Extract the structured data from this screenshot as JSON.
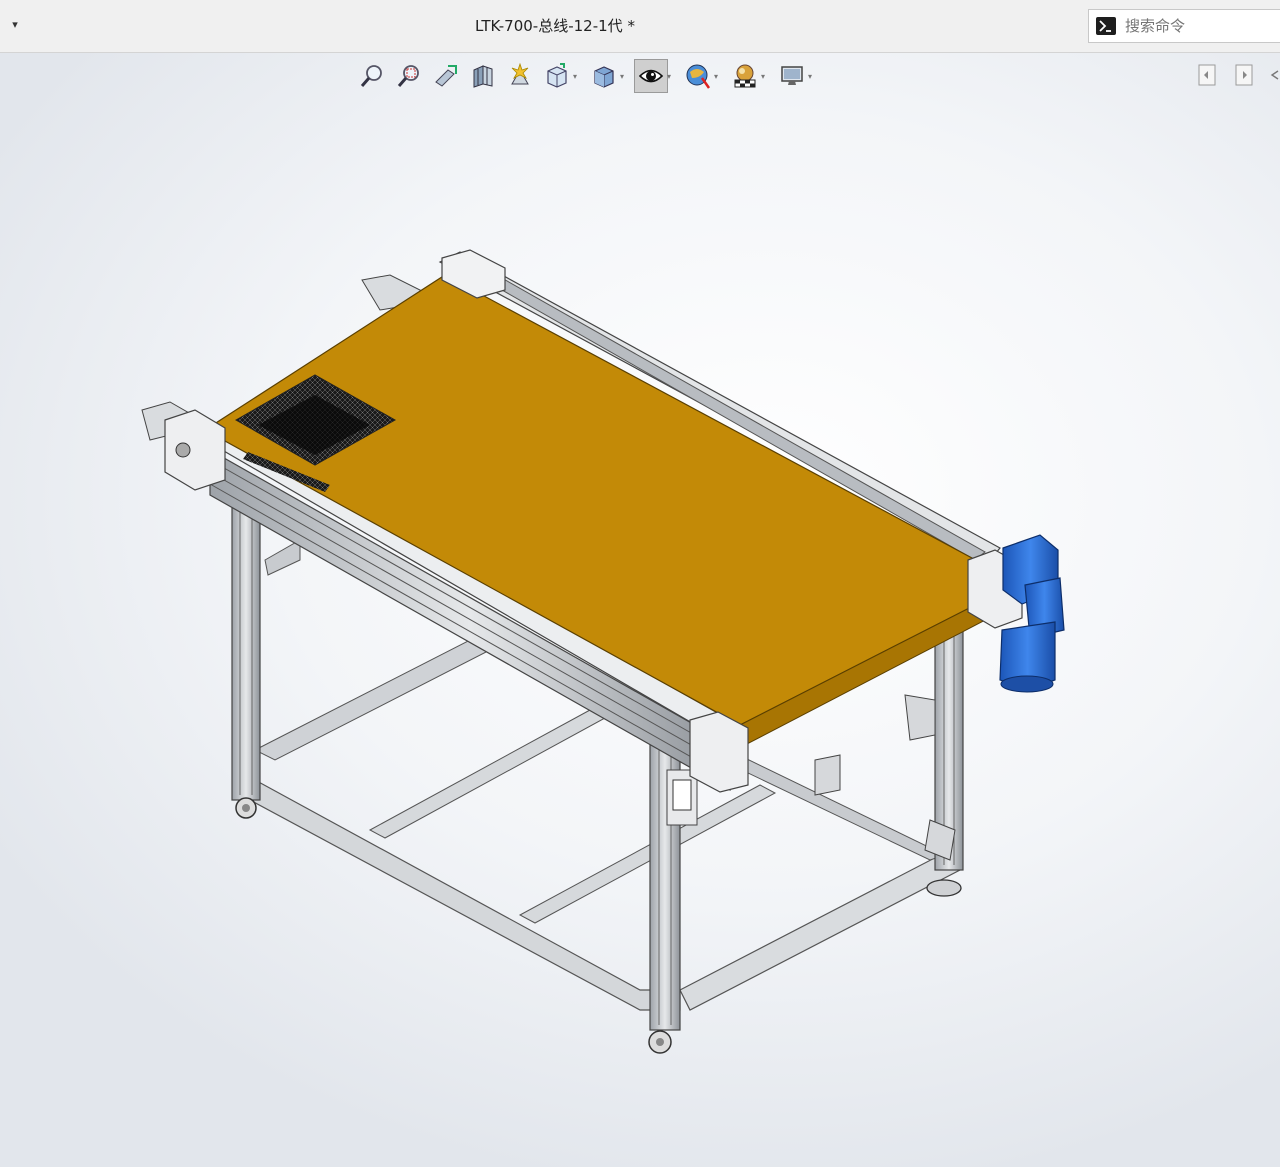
{
  "titlebar": {
    "document_title": "LTK-700-总线-12-1代 *",
    "search_placeholder": "搜索命令"
  },
  "heads_up_toolbar": {
    "tools": [
      {
        "icon": "zoom-to-fit-icon",
        "has_dropdown": false
      },
      {
        "icon": "zoom-to-area-icon",
        "has_dropdown": false
      },
      {
        "icon": "previous-view-icon",
        "has_dropdown": false
      },
      {
        "icon": "section-view-icon",
        "has_dropdown": false
      },
      {
        "icon": "dynamic-annotation-views-icon",
        "has_dropdown": false
      },
      {
        "icon": "view-orientation-icon",
        "has_dropdown": true
      },
      {
        "icon": "display-style-icon",
        "has_dropdown": true
      },
      {
        "icon": "hide-show-items-icon",
        "has_dropdown": true,
        "pressed": true
      },
      {
        "icon": "edit-appearance-icon",
        "has_dropdown": true
      },
      {
        "icon": "apply-scene-icon",
        "has_dropdown": true
      },
      {
        "icon": "view-settings-icon",
        "has_dropdown": true
      }
    ]
  },
  "model": {
    "belt_color": "#c38a07",
    "frame_color": "#c9ccd0",
    "motor_color": "#2f6fd6"
  }
}
